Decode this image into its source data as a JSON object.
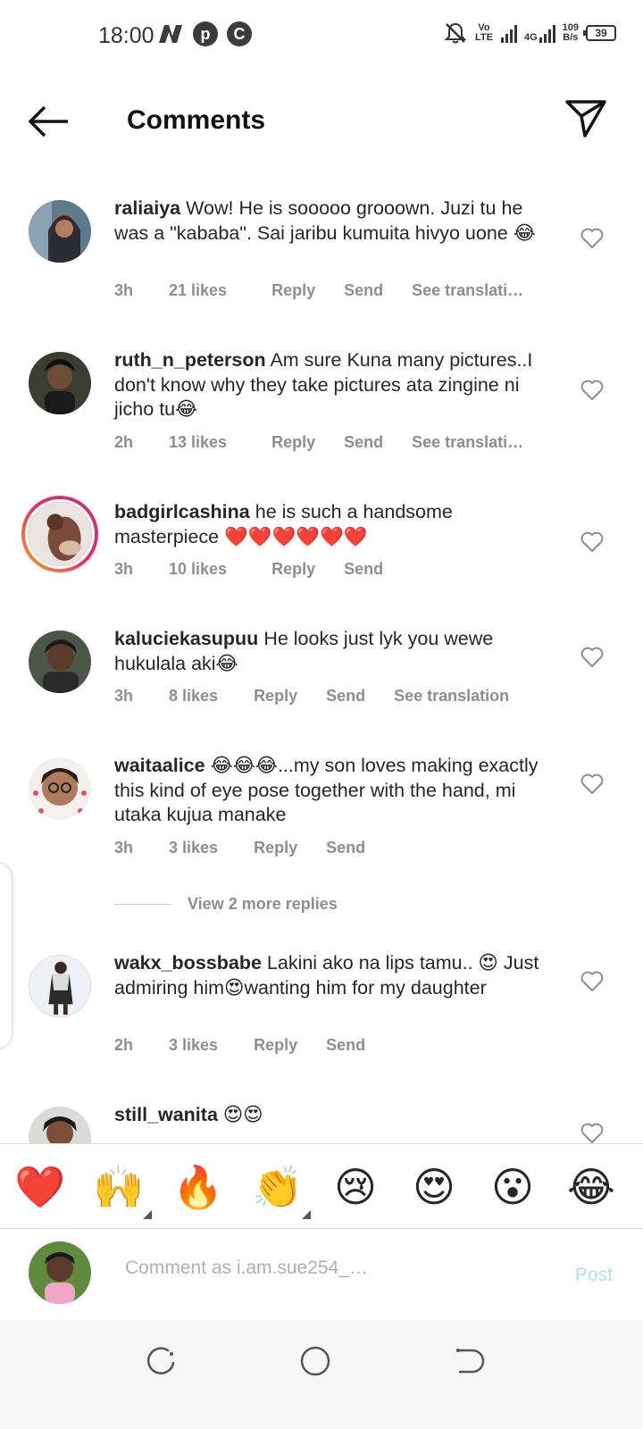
{
  "status_bar": {
    "time": "18:00",
    "left_icons": [
      "n-app-icon",
      "pinterest-icon",
      "c-app-icon"
    ],
    "volte": "Vo LTE",
    "network": "4G",
    "data_speed_value": "109",
    "data_speed_unit": "B/s",
    "battery": "39"
  },
  "header": {
    "title": "Comments",
    "back_icon": "arrow-left-icon",
    "send_icon": "paper-plane-icon"
  },
  "comments": [
    {
      "username": "raliaiya",
      "text": "Wow! He is sooooo grooown. Juzi tu he was a \"kababa\". Sai jaribu kumuita hivyo uone 😂",
      "time": "3h",
      "likes": "21 likes",
      "reply": "Reply",
      "send": "Send",
      "translate": "See translati…"
    },
    {
      "username": "ruth_n_peterson",
      "text": "Am sure Kuna many pictures..I don't know why they take pictures ata zingine ni jicho tu😂",
      "time": "2h",
      "likes": "13 likes",
      "reply": "Reply",
      "send": "Send",
      "translate": "See translati…"
    },
    {
      "username": "badgirlcashina",
      "text": "he is such a handsome masterpiece ❤️❤️❤️❤️❤️❤️",
      "time": "3h",
      "likes": "10 likes",
      "reply": "Reply",
      "send": "Send"
    },
    {
      "username": "kaluciekasupuu",
      "text": "He looks just lyk you wewe hukulala aki😂",
      "time": "3h",
      "likes": "8 likes",
      "reply": "Reply",
      "send": "Send",
      "translate": "See translation"
    },
    {
      "username": "waitaalice",
      "text": "😂😂😂...my son loves making exactly this kind of eye pose together with the hand, mi utaka kujua manake",
      "time": "3h",
      "likes": "3 likes",
      "reply": "Reply",
      "send": "Send"
    },
    {
      "username": "wakx_bossbabe",
      "text": "Lakini ako na lips tamu.. 😍 Just admiring him😍wanting him for my daughter",
      "time": "2h",
      "likes": "3 likes",
      "reply": "Reply",
      "send": "Send"
    },
    {
      "username": "still_wanita",
      "text": "😍😍"
    }
  ],
  "view_replies": "View 2 more replies",
  "emoji_bar": [
    "❤️",
    "🙌",
    "🔥",
    "👏",
    "😢",
    "😍",
    "😮",
    "😂"
  ],
  "composer": {
    "placeholder": "Comment as i.am.sue254_…",
    "post_label": "Post"
  },
  "nav_bar": [
    "recents-icon",
    "home-circle-icon",
    "back-nav-icon"
  ]
}
